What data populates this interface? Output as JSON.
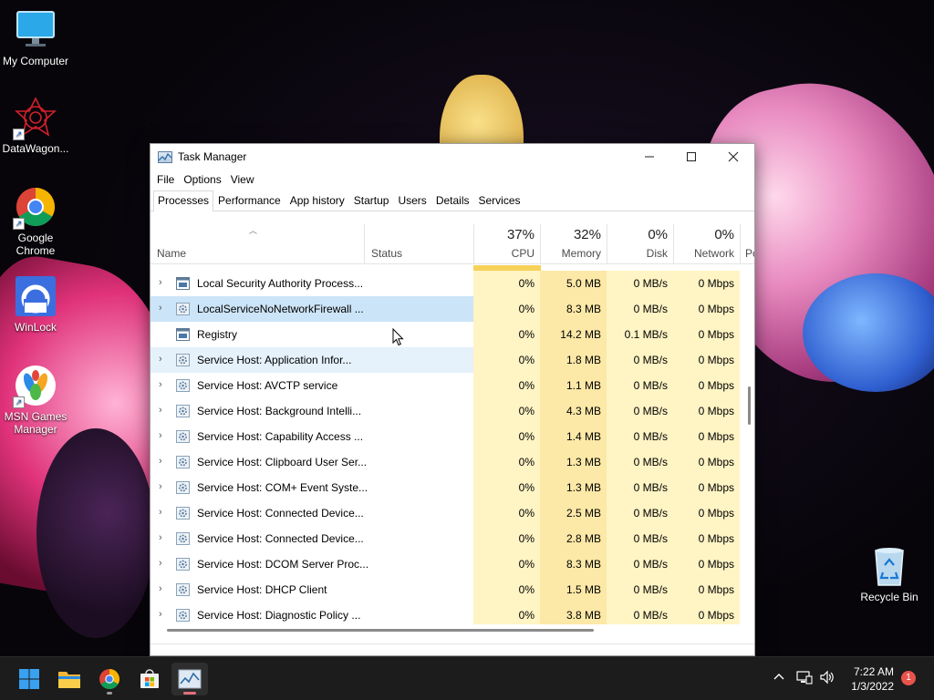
{
  "desktop": {
    "icons": [
      {
        "label": "My Computer",
        "icon": "monitor-icon"
      },
      {
        "label": "DataWagon...",
        "icon": "datawagon-icon"
      },
      {
        "label": "Google Chrome",
        "icon": "chrome-icon"
      },
      {
        "label": "WinLock",
        "icon": "winlock-icon"
      },
      {
        "label": "MSN Games Manager",
        "icon": "msn-games-icon"
      },
      {
        "label": "Recycle Bin",
        "icon": "recycle-bin-icon"
      }
    ]
  },
  "window": {
    "title": "Task Manager",
    "controls": {
      "minimize": "—",
      "maximize": "☐",
      "close": "✕"
    },
    "menu": [
      "File",
      "Options",
      "View"
    ],
    "tabs": [
      "Processes",
      "Performance",
      "App history",
      "Startup",
      "Users",
      "Details",
      "Services"
    ],
    "active_tab": "Processes",
    "columns": {
      "name": {
        "label": "Name"
      },
      "status": {
        "label": "Status"
      },
      "cpu": {
        "pct": "37%",
        "label": "CPU"
      },
      "memory": {
        "pct": "32%",
        "label": "Memory"
      },
      "disk": {
        "pct": "0%",
        "label": "Disk"
      },
      "network": {
        "pct": "0%",
        "label": "Network"
      },
      "power": {
        "label": "Po"
      }
    },
    "processes": [
      {
        "name": "Local Security Authority Process...",
        "icon": "window-app-icon",
        "expandable": true,
        "cpu": "0%",
        "memory": "5.0 MB",
        "disk": "0 MB/s",
        "network": "0 Mbps"
      },
      {
        "name": "LocalServiceNoNetworkFirewall ...",
        "icon": "gear-icon",
        "expandable": true,
        "cpu": "0%",
        "memory": "8.3 MB",
        "disk": "0 MB/s",
        "network": "0 Mbps"
      },
      {
        "name": "Registry",
        "icon": "window-app-icon",
        "expandable": false,
        "cpu": "0%",
        "memory": "14.2 MB",
        "disk": "0.1 MB/s",
        "network": "0 Mbps"
      },
      {
        "name": "Service Host: Application Infor...",
        "icon": "gear-icon",
        "expandable": true,
        "cpu": "0%",
        "memory": "1.8 MB",
        "disk": "0 MB/s",
        "network": "0 Mbps"
      },
      {
        "name": "Service Host: AVCTP service",
        "icon": "gear-icon",
        "expandable": true,
        "cpu": "0%",
        "memory": "1.1 MB",
        "disk": "0 MB/s",
        "network": "0 Mbps"
      },
      {
        "name": "Service Host: Background Intelli...",
        "icon": "gear-icon",
        "expandable": true,
        "cpu": "0%",
        "memory": "4.3 MB",
        "disk": "0 MB/s",
        "network": "0 Mbps"
      },
      {
        "name": "Service Host: Capability Access ...",
        "icon": "gear-icon",
        "expandable": true,
        "cpu": "0%",
        "memory": "1.4 MB",
        "disk": "0 MB/s",
        "network": "0 Mbps"
      },
      {
        "name": "Service Host: Clipboard User Ser...",
        "icon": "gear-icon",
        "expandable": true,
        "cpu": "0%",
        "memory": "1.3 MB",
        "disk": "0 MB/s",
        "network": "0 Mbps"
      },
      {
        "name": "Service Host: COM+ Event Syste...",
        "icon": "gear-icon",
        "expandable": true,
        "cpu": "0%",
        "memory": "1.3 MB",
        "disk": "0 MB/s",
        "network": "0 Mbps"
      },
      {
        "name": "Service Host: Connected Device...",
        "icon": "gear-icon",
        "expandable": true,
        "cpu": "0%",
        "memory": "2.5 MB",
        "disk": "0 MB/s",
        "network": "0 Mbps"
      },
      {
        "name": "Service Host: Connected Device...",
        "icon": "gear-icon",
        "expandable": true,
        "cpu": "0%",
        "memory": "2.8 MB",
        "disk": "0 MB/s",
        "network": "0 Mbps"
      },
      {
        "name": "Service Host: DCOM Server Proc...",
        "icon": "gear-icon",
        "expandable": true,
        "cpu": "0%",
        "memory": "8.3 MB",
        "disk": "0 MB/s",
        "network": "0 Mbps"
      },
      {
        "name": "Service Host: DHCP Client",
        "icon": "gear-icon",
        "expandable": true,
        "cpu": "0%",
        "memory": "1.5 MB",
        "disk": "0 MB/s",
        "network": "0 Mbps"
      },
      {
        "name": "Service Host: Diagnostic Policy ...",
        "icon": "gear-icon",
        "expandable": true,
        "cpu": "0%",
        "memory": "3.8 MB",
        "disk": "0 MB/s",
        "network": "0 Mbps"
      }
    ],
    "selected_row": 1,
    "hover_row": 3
  },
  "taskbar": {
    "apps": [
      {
        "name": "start",
        "icon": "windows-start-icon"
      },
      {
        "name": "file-explorer",
        "icon": "folder-icon"
      },
      {
        "name": "chrome",
        "icon": "chrome-icon"
      },
      {
        "name": "store",
        "icon": "store-icon"
      },
      {
        "name": "task-manager",
        "icon": "task-manager-icon"
      }
    ],
    "tray_icons": [
      "chevron-up-icon",
      "network-icon",
      "volume-icon"
    ],
    "time": "7:22 AM",
    "date": "1/3/2022",
    "notification_count": "1"
  },
  "colors": {
    "cpu_heat": "#fff4c4",
    "memory_heat": "#fce8a7",
    "selection": "#cce4f7",
    "taskbar": "#1c1c1c",
    "notification": "#e8534c"
  }
}
